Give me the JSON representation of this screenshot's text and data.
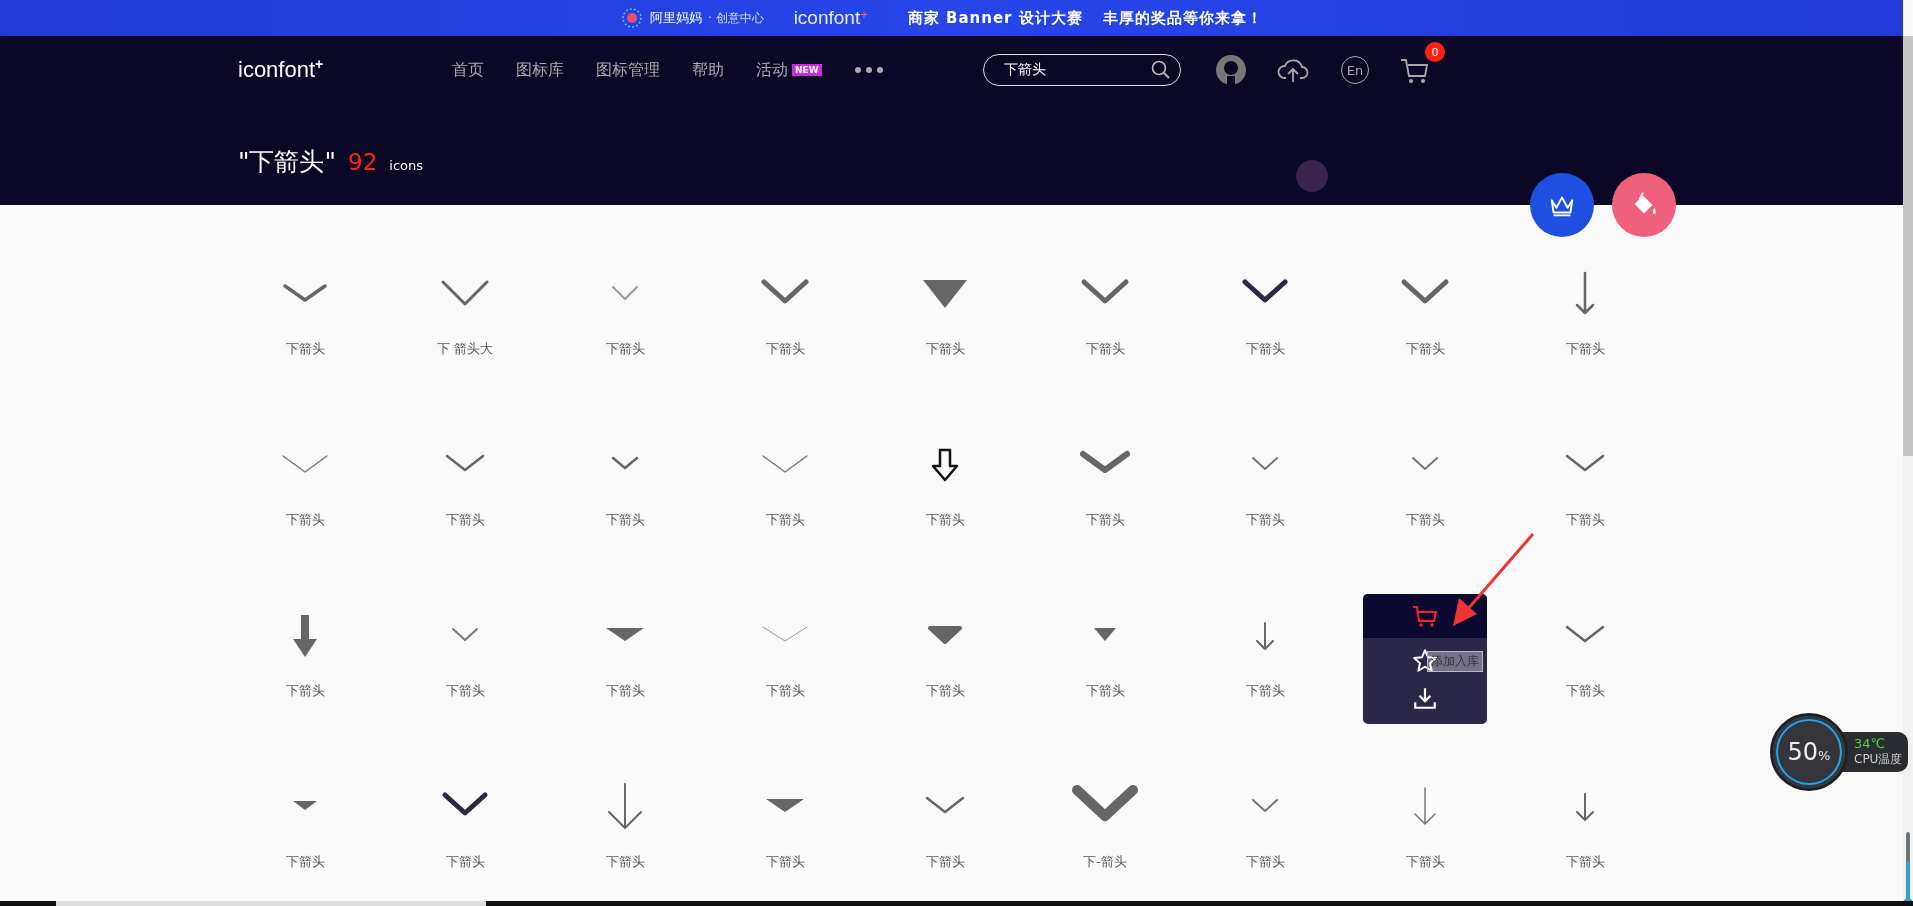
{
  "banner": {
    "brand": "阿里妈妈",
    "subtitle": "· 创意中心",
    "logo": "iconfont",
    "logo_mark": "+",
    "headline": "商家 Banner 设计大赛",
    "tagline": "丰厚的奖品等你来拿！"
  },
  "header": {
    "logo": "iconfont",
    "logo_mark": "+",
    "nav": [
      {
        "label": "首页"
      },
      {
        "label": "图标库"
      },
      {
        "label": "图标管理"
      },
      {
        "label": "帮助"
      },
      {
        "label": "活动",
        "badge": "NEW"
      }
    ],
    "search": {
      "value": "下箭头"
    },
    "language": "En",
    "cart_count": "0"
  },
  "results": {
    "query": "\"下箭头\"",
    "count": "92",
    "unit": "icons"
  },
  "icons": [
    {
      "label": "下箭头",
      "kind": "chevron",
      "hovered": false
    },
    {
      "label": "下 箭头大",
      "kind": "chevron-wide",
      "hovered": false
    },
    {
      "label": "下箭头",
      "kind": "chevron-light",
      "hovered": false
    },
    {
      "label": "下箭头",
      "kind": "chevron-bold",
      "hovered": false
    },
    {
      "label": "下箭头",
      "kind": "triangle",
      "hovered": false
    },
    {
      "label": "下箭头",
      "kind": "chevron-bold",
      "hovered": false
    },
    {
      "label": "下箭头",
      "kind": "chevron-dark",
      "hovered": false
    },
    {
      "label": "下箭头",
      "kind": "chevron-bold",
      "hovered": false
    },
    {
      "label": "下箭头",
      "kind": "arrow",
      "hovered": false
    },
    {
      "label": "下箭头",
      "kind": "chevron-thin",
      "hovered": false
    },
    {
      "label": "下箭头",
      "kind": "chevron-mid",
      "hovered": false
    },
    {
      "label": "下箭头",
      "kind": "chevron-small",
      "hovered": false
    },
    {
      "label": "下箭头",
      "kind": "chevron-thin",
      "hovered": false
    },
    {
      "label": "下箭头",
      "kind": "arrow-outline",
      "hovered": false
    },
    {
      "label": "下箭头",
      "kind": "chevron-heavy",
      "hovered": false
    },
    {
      "label": "下箭头",
      "kind": "chevron-small-thin",
      "hovered": false
    },
    {
      "label": "下箭头",
      "kind": "chevron-small-thin",
      "hovered": false
    },
    {
      "label": "下箭头",
      "kind": "chevron-mid",
      "hovered": false
    },
    {
      "label": "下箭头",
      "kind": "arrow-solid",
      "hovered": false
    },
    {
      "label": "下箭头",
      "kind": "chevron-small-thin",
      "hovered": false
    },
    {
      "label": "下箭头",
      "kind": "triangle-flat",
      "hovered": false
    },
    {
      "label": "下箭头",
      "kind": "chevron-hairline",
      "hovered": false
    },
    {
      "label": "下箭头",
      "kind": "triangle-rounded",
      "hovered": false
    },
    {
      "label": "下箭头",
      "kind": "triangle-small",
      "hovered": false
    },
    {
      "label": "下箭头",
      "kind": "arrow-small",
      "hovered": false
    },
    {
      "hovered": true
    },
    {
      "label": "下箭头",
      "kind": "chevron-mid",
      "hovered": false
    },
    {
      "label": "下箭头",
      "kind": "triangle-flat-small",
      "hovered": false
    },
    {
      "label": "下箭头",
      "kind": "chevron-dark",
      "hovered": false
    },
    {
      "label": "下箭头",
      "kind": "arrow-large",
      "hovered": false
    },
    {
      "label": "下箭头",
      "kind": "triangle-flat",
      "hovered": false
    },
    {
      "label": "下箭头",
      "kind": "chevron-mid",
      "hovered": false
    },
    {
      "label": "下-箭头",
      "kind": "chevron-huge",
      "hovered": false
    },
    {
      "label": "下箭头",
      "kind": "chevron-small-thin",
      "hovered": false
    },
    {
      "label": "下箭头",
      "kind": "arrow-thin",
      "hovered": false
    },
    {
      "label": "下箭头",
      "kind": "arrow-small",
      "hovered": false
    }
  ],
  "hover_tooltip": "添加入库",
  "cpu": {
    "load": "50",
    "unit": "%",
    "temp": "34℃",
    "label": "CPU温度"
  }
}
